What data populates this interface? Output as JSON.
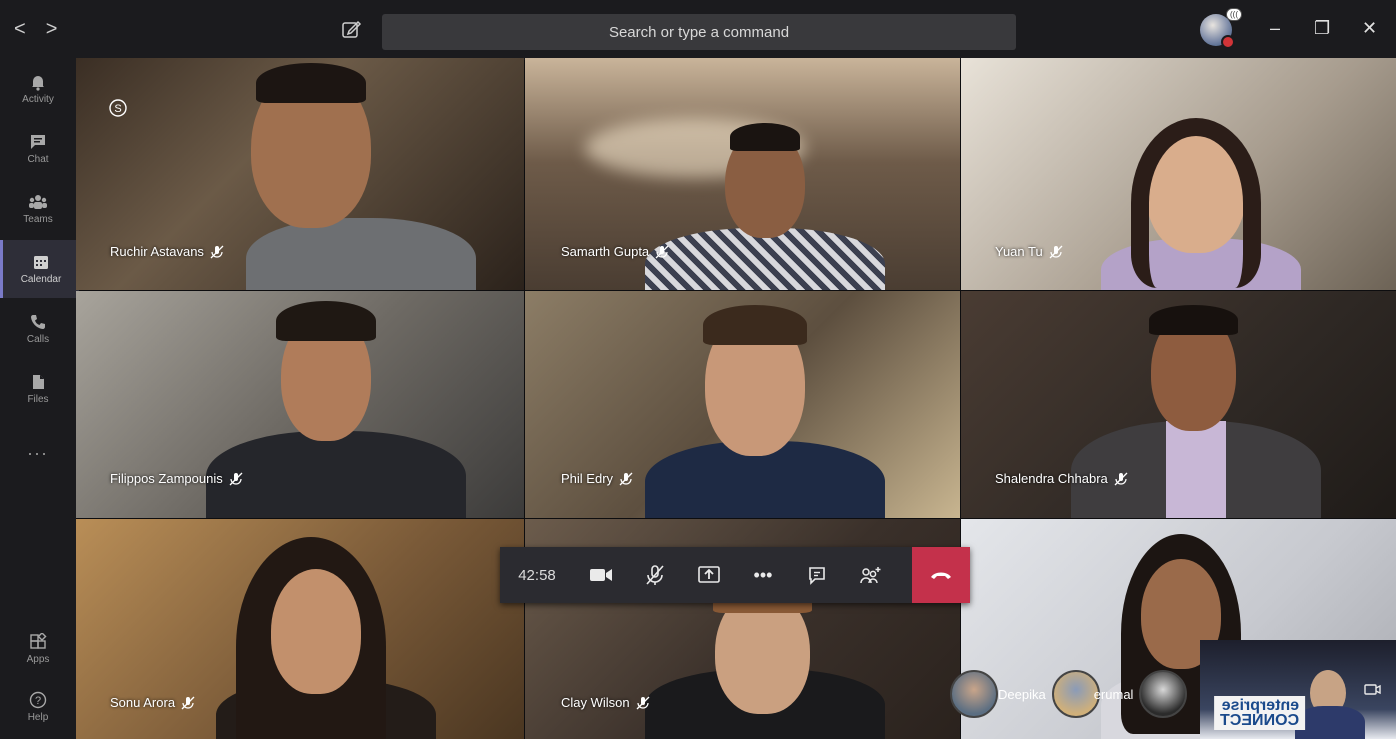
{
  "topbar": {
    "back_icon": "chevron-left-icon",
    "forward_icon": "chevron-right-icon",
    "back_label": "<",
    "forward_label": ">",
    "compose_icon": "compose-icon",
    "search_placeholder": "Search or type a command",
    "profile_badge": "(((",
    "minimize_label": "–",
    "restore_label": "❐",
    "close_label": "✕"
  },
  "rail": {
    "items": [
      {
        "label": "Activity",
        "icon": "bell-icon"
      },
      {
        "label": "Chat",
        "icon": "chat-icon"
      },
      {
        "label": "Teams",
        "icon": "teams-icon"
      },
      {
        "label": "Calendar",
        "icon": "calendar-icon",
        "active": true
      },
      {
        "label": "Calls",
        "icon": "phone-icon"
      },
      {
        "label": "Files",
        "icon": "file-icon"
      },
      {
        "label": "...",
        "icon": "more-icon"
      },
      {
        "label": "Apps",
        "icon": "apps-icon"
      },
      {
        "label": "Help",
        "icon": "help-icon"
      }
    ]
  },
  "participants": [
    {
      "name": "Ruchir Astavans"
    },
    {
      "name": "Samarth Gupta"
    },
    {
      "name": "Yuan Tu"
    },
    {
      "name": "Filippos Zampounis"
    },
    {
      "name": "Phil Edry"
    },
    {
      "name": "Shalendra Chhabra"
    },
    {
      "name": "Sonu Arora"
    },
    {
      "name": "Clay Wilson"
    },
    {
      "name": ""
    }
  ],
  "controls": {
    "timer": "42:58",
    "more_label": "•••"
  },
  "overflow": {
    "label1": "Deepika",
    "label2": "erumal"
  },
  "selfview": {
    "logo_line1": "enterprise",
    "logo_line2": "CONNECT"
  },
  "colors": {
    "hangup": "#c4314b",
    "accent": "#7a7ac8"
  }
}
